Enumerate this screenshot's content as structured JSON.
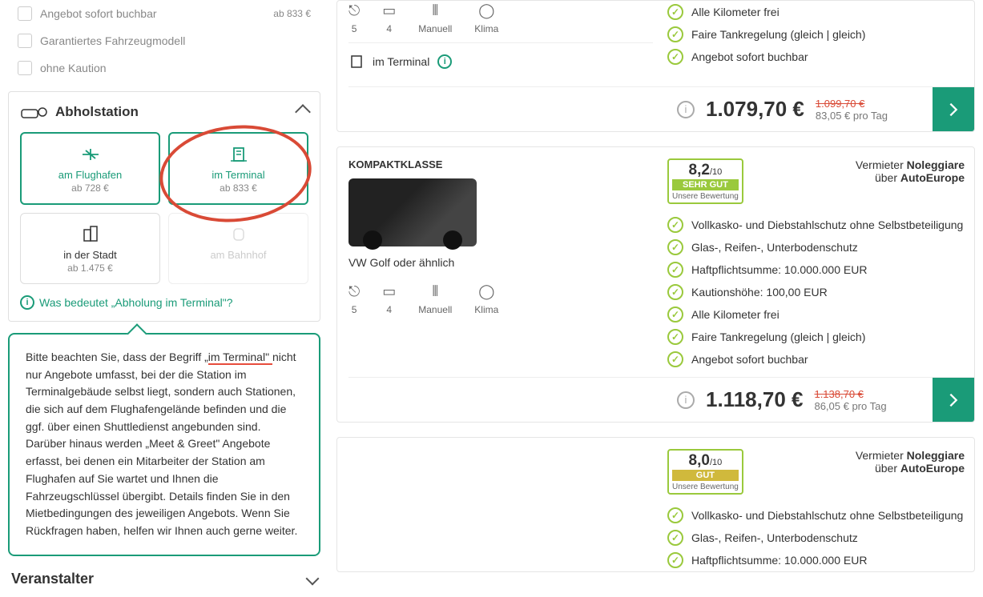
{
  "filters": {
    "instant": {
      "label": "Angebot sofort buchbar",
      "price": "ab 833 €"
    },
    "model": {
      "label": "Garantiertes Fahrzeugmodell"
    },
    "nodeposit": {
      "label": "ohne Kaution"
    }
  },
  "pickup_section": {
    "title": "Abholstation",
    "items": [
      {
        "key": "airport",
        "label": "am Flughafen",
        "price": "ab 728 €"
      },
      {
        "key": "terminal",
        "label": "im Terminal",
        "price": "ab 833 €"
      },
      {
        "key": "city",
        "label": "in der Stadt",
        "price": "ab 1.475 €"
      },
      {
        "key": "train",
        "label": "am Bahnhof",
        "price": ""
      }
    ],
    "info_link": "Was bedeutet „Abholung im Terminal\"?"
  },
  "tooltip": {
    "pre": "Bitte beachten Sie, dass der Begriff „",
    "highlight": "im Terminal\" ",
    "post": "nicht nur Angebote umfasst, bei der die Station im Terminalgebäude selbst liegt, sondern auch Stationen, die sich auf dem Flughafengelände befinden und die ggf. über einen Shuttledienst angebunden sind. Darüber hinaus werden „Meet & Greet\" Angebote erfasst, bei denen ein Mitarbeiter der Station am Flughafen auf Sie wartet und Ihnen die Fahrzeugschlüssel übergibt. Details finden Sie in den Mietbedingungen des jeweiligen Angebots. Wenn Sie Rückfragen haben, helfen wir Ihnen auch gerne weiter."
  },
  "veranstalter": "Veranstalter",
  "specs_labels": {
    "seats": "5",
    "doors": "4",
    "trans": "Manuell",
    "ac": "Klima"
  },
  "vendor_labels": {
    "pre": "Vermieter ",
    "name": "Noleggiare",
    "via_pre": "über ",
    "via": "AutoEurope"
  },
  "rating_sub": "Unsere Bewertung",
  "location_label": "im Terminal",
  "features_common": [
    "Vollkasko- und Diebstahlschutz ohne Selbstbeteiligung",
    "Glas-, Reifen-, Unterbodenschutz",
    "Haftpflichtsumme: 10.000.000 EUR"
  ],
  "features_extra": [
    "Kautionshöhe: 100,00 EUR",
    "Alle Kilometer frei",
    "Faire Tankregelung (gleich | gleich)",
    "Angebot sofort buchbar"
  ],
  "offer0": {
    "features_top": [
      "Alle Kilometer frei",
      "Faire Tankregelung (gleich | gleich)",
      "Angebot sofort buchbar"
    ],
    "price": "1.079,70 €",
    "old": "1.099,70 €",
    "perday": "83,05 € pro Tag"
  },
  "offer1": {
    "category": "KOMPAKTKLASSE",
    "car": "VW Golf oder ähnlich",
    "score": "8,2",
    "scale": "/10",
    "rating_label": "SEHR GUT",
    "price": "1.118,70 €",
    "old": "1.138,70 €",
    "perday": "86,05 € pro Tag"
  },
  "offer2": {
    "score": "8,0",
    "scale": "/10",
    "rating_label": "GUT"
  }
}
